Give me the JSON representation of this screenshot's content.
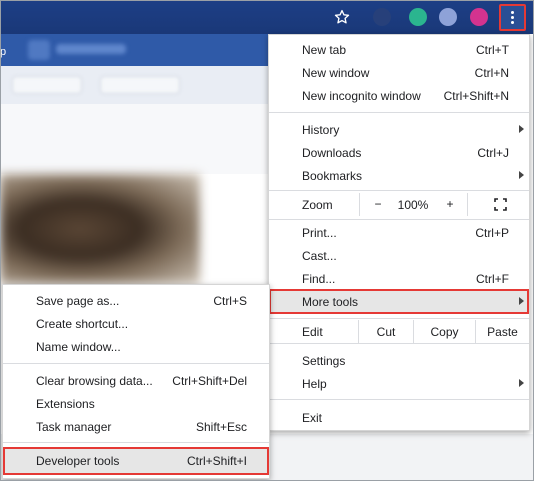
{
  "toolbar": {
    "icons": [
      "star-icon",
      "extension-icon",
      "extension-icon",
      "extension-icon",
      "extension-icon",
      "kebab-menu-icon"
    ]
  },
  "page": {
    "tip_text": "p"
  },
  "main_menu": {
    "new_tab": {
      "label": "New tab",
      "shortcut": "Ctrl+T"
    },
    "new_window": {
      "label": "New window",
      "shortcut": "Ctrl+N"
    },
    "new_incognito": {
      "label": "New incognito window",
      "shortcut": "Ctrl+Shift+N"
    },
    "history": {
      "label": "History"
    },
    "downloads": {
      "label": "Downloads",
      "shortcut": "Ctrl+J"
    },
    "bookmarks": {
      "label": "Bookmarks"
    },
    "zoom": {
      "label": "Zoom",
      "minus": "−",
      "value": "100%",
      "plus": "+"
    },
    "print": {
      "label": "Print...",
      "shortcut": "Ctrl+P"
    },
    "cast": {
      "label": "Cast..."
    },
    "find": {
      "label": "Find...",
      "shortcut": "Ctrl+F"
    },
    "more_tools": {
      "label": "More tools"
    },
    "edit": {
      "label": "Edit",
      "cut": "Cut",
      "copy": "Copy",
      "paste": "Paste"
    },
    "settings": {
      "label": "Settings"
    },
    "help": {
      "label": "Help"
    },
    "exit": {
      "label": "Exit"
    }
  },
  "sub_menu": {
    "save_page": {
      "label": "Save page as...",
      "shortcut": "Ctrl+S"
    },
    "create_shortcut": {
      "label": "Create shortcut..."
    },
    "name_window": {
      "label": "Name window..."
    },
    "clear_browsing": {
      "label": "Clear browsing data...",
      "shortcut": "Ctrl+Shift+Del"
    },
    "extensions": {
      "label": "Extensions"
    },
    "task_manager": {
      "label": "Task manager",
      "shortcut": "Shift+Esc"
    },
    "developer_tools": {
      "label": "Developer tools",
      "shortcut": "Ctrl+Shift+I"
    }
  },
  "colors": {
    "highlight_border": "#e53935",
    "toolbar": "#1d3f86"
  }
}
